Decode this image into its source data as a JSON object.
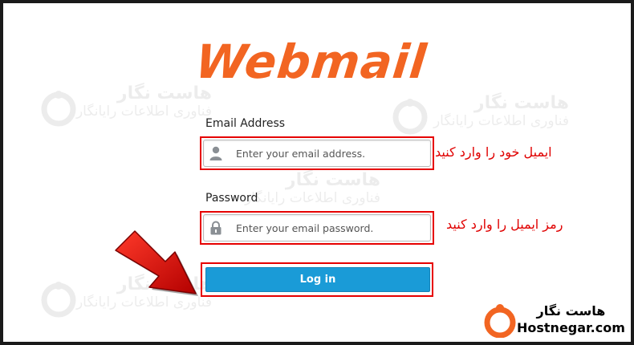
{
  "logo": {
    "text": "Webmail"
  },
  "form": {
    "email_label": "Email Address",
    "email_placeholder": "Enter your email address.",
    "password_label": "Password",
    "password_placeholder": "Enter your email password.",
    "login_label": "Log in"
  },
  "annotations": {
    "email_hint": "ایمیل خود را وارد کنید",
    "password_hint": "رمز ایمیل را وارد کنید"
  },
  "watermark": {
    "title": "هاست نگار",
    "subtitle": "فناوری اطلاعات رایانگار"
  },
  "brand": {
    "name_fa": "هاست نگار",
    "site": "Hostnegar.com",
    "icon": "hostnegar-logo-icon"
  },
  "colors": {
    "accent": "#f26522",
    "button": "#1a9bd7",
    "highlight": "#e60000"
  }
}
